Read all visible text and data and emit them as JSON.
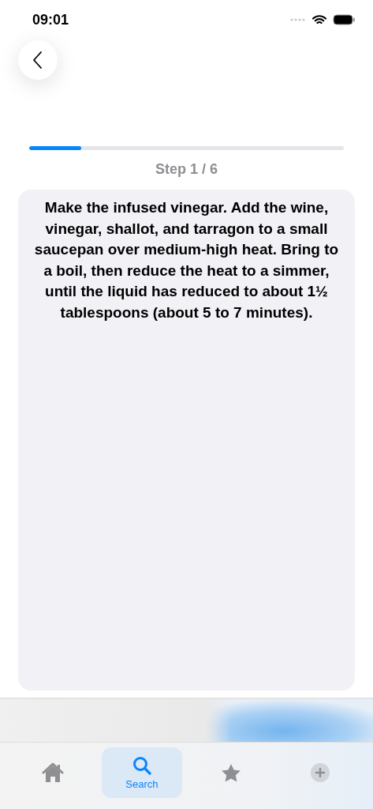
{
  "status_bar": {
    "time": "09:01"
  },
  "progress": {
    "level": 0.165,
    "label": "Step 1 / 6"
  },
  "step": {
    "text": "Make the infused vinegar. Add the wine, vinegar, shallot, and tarragon to a small saucepan over medium-high heat. Bring to a boil, then reduce the heat to a simmer, until the liquid has reduced to about 1½ tablespoons (about 5 to 7 minutes)."
  },
  "tabs": [
    {
      "kind": "home",
      "selected": false
    },
    {
      "kind": "search",
      "label": "Search",
      "selected": true
    },
    {
      "kind": "star",
      "selected": false
    },
    {
      "kind": "add",
      "selected": false
    }
  ]
}
